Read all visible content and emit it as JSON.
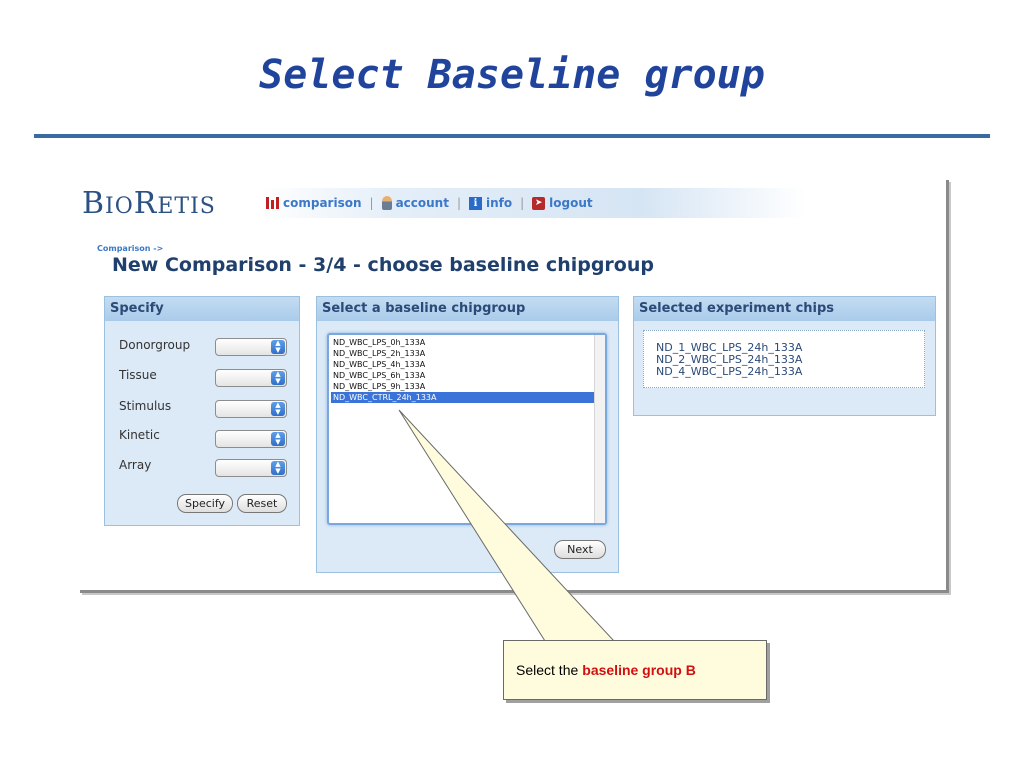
{
  "slide": {
    "title": "Select Baseline group"
  },
  "app": {
    "logo": {
      "big1": "B",
      "small1": "IO",
      "big2": "R",
      "small2": "ETIS"
    },
    "nav": [
      {
        "label": "comparison",
        "icon": "bar-chart-icon"
      },
      {
        "label": "account",
        "icon": "user-icon"
      },
      {
        "label": "info",
        "icon": "info-icon"
      },
      {
        "label": "logout",
        "icon": "logout-icon"
      }
    ],
    "nav_separator": "|",
    "breadcrumb": "Comparison ->",
    "heading": "New Comparison - 3/4 - choose baseline chipgroup"
  },
  "specify_panel": {
    "title": "Specify",
    "fields": [
      {
        "label": "Donorgroup",
        "value": ""
      },
      {
        "label": "Tissue",
        "value": ""
      },
      {
        "label": "Stimulus",
        "value": ""
      },
      {
        "label": "Kinetic",
        "value": ""
      },
      {
        "label": "Array",
        "value": ""
      }
    ],
    "specify_button": "Specify",
    "reset_button": "Reset"
  },
  "baseline_panel": {
    "title": "Select a baseline chipgroup",
    "items": [
      "ND_WBC_LPS_0h_133A",
      "ND_WBC_LPS_2h_133A",
      "ND_WBC_LPS_4h_133A",
      "ND_WBC_LPS_6h_133A",
      "ND_WBC_LPS_9h_133A",
      "ND_WBC_CTRL_24h_133A"
    ],
    "selected": "ND_WBC_CTRL_24h_133A",
    "next_button": "Next"
  },
  "selected_panel": {
    "title": "Selected experiment chips",
    "chips": [
      "ND_1_WBC_LPS_24h_133A",
      "ND_2_WBC_LPS_24h_133A",
      "ND_4_WBC_LPS_24h_133A"
    ]
  },
  "callout": {
    "text": "Select the",
    "highlight": "baseline group B"
  },
  "colors": {
    "title": "#20439b",
    "accent": "#3b74d8",
    "panel_bg": "#dce9f6",
    "callout_bg": "#fffcdd",
    "highlight": "#d11010"
  }
}
